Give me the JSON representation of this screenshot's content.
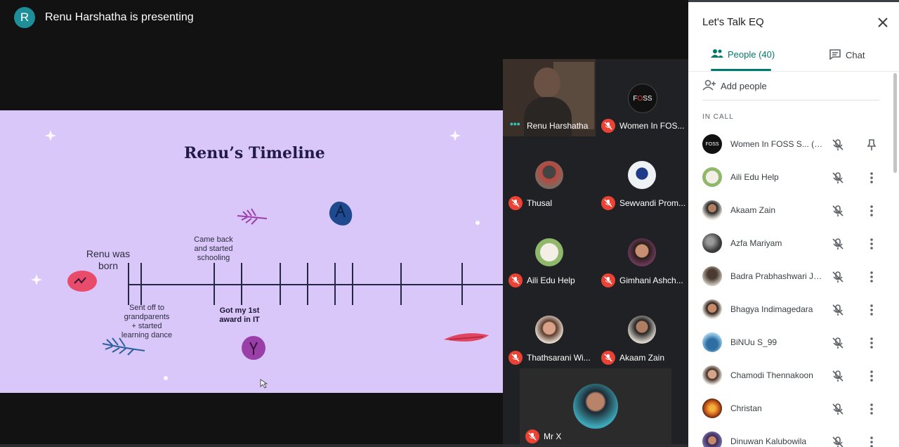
{
  "presenter": {
    "initial": "R",
    "text": "Renu Harshatha is presenting"
  },
  "slide": {
    "title": "Renu’s Timeline",
    "born_line1": "Renu was",
    "born_line2": "born",
    "came_back_1": "Came back",
    "came_back_2": "and started",
    "came_back_3": "schooling",
    "sent_off_1": "Sent off to",
    "sent_off_2": "grandparents",
    "sent_off_3": "+ started",
    "sent_off_4": "learning dance",
    "award_1": "Got my 1st",
    "award_2": "award in IT"
  },
  "tiles": [
    {
      "name": "Renu Harshatha",
      "muted": false
    },
    {
      "name": "Women In FOS...",
      "muted": true
    },
    {
      "name": "Thusal",
      "muted": true
    },
    {
      "name": "Sewvandi Prom...",
      "muted": true
    },
    {
      "name": "Aili Edu Help",
      "muted": true
    },
    {
      "name": "Gimhani Ashch...",
      "muted": true
    },
    {
      "name": "Thathsarani Wi...",
      "muted": true
    },
    {
      "name": "Akaam Zain",
      "muted": true
    },
    {
      "name": "Mr X",
      "muted": true
    }
  ],
  "panel": {
    "title": "Let's Talk EQ",
    "tab_people": "People (40)",
    "tab_chat": "Chat",
    "add_people": "Add people",
    "section": "IN CALL",
    "participants": [
      {
        "name": "Women In FOSS S...",
        "you": "(You)"
      },
      {
        "name": "Aili Edu Help"
      },
      {
        "name": "Akaam Zain"
      },
      {
        "name": "Azfa Mariyam"
      },
      {
        "name": "Badra Prabhashwari Jay..."
      },
      {
        "name": "Bhagya Indimagedara"
      },
      {
        "name": "BiNUu S_99"
      },
      {
        "name": "Chamodi Thennakoon"
      },
      {
        "name": "Christan"
      },
      {
        "name": "Dinuwan Kalubowila"
      }
    ]
  },
  "colors": {
    "accent": "#00796b",
    "muted_red": "#ea4335",
    "slide_bg": "#d9c7fa"
  }
}
